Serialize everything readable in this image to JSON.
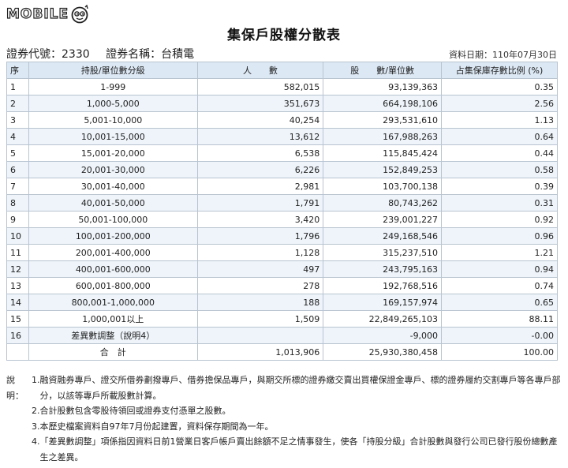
{
  "logo": {
    "text": "MOBILE"
  },
  "title": "集保戶股權分散表",
  "meta": {
    "stock_code": "證券代號：2330",
    "stock_name": "證券名稱：台積電",
    "data_date": "資料日期：110年07月30日"
  },
  "table": {
    "headers": [
      "序",
      "持股/單位數分級",
      "人　　數",
      "股　　數/單位數",
      "占集保庫存數比例 (%)"
    ],
    "rows": [
      [
        "1",
        "1-999",
        "582,015",
        "93,139,363",
        "0.35"
      ],
      [
        "2",
        "1,000-5,000",
        "351,673",
        "664,198,106",
        "2.56"
      ],
      [
        "3",
        "5,001-10,000",
        "40,254",
        "293,531,610",
        "1.13"
      ],
      [
        "4",
        "10,001-15,000",
        "13,612",
        "167,988,263",
        "0.64"
      ],
      [
        "5",
        "15,001-20,000",
        "6,538",
        "115,845,424",
        "0.44"
      ],
      [
        "6",
        "20,001-30,000",
        "6,226",
        "152,849,253",
        "0.58"
      ],
      [
        "7",
        "30,001-40,000",
        "2,981",
        "103,700,138",
        "0.39"
      ],
      [
        "8",
        "40,001-50,000",
        "1,791",
        "80,743,262",
        "0.31"
      ],
      [
        "9",
        "50,001-100,000",
        "3,420",
        "239,001,227",
        "0.92"
      ],
      [
        "10",
        "100,001-200,000",
        "1,796",
        "249,168,546",
        "0.96"
      ],
      [
        "11",
        "200,001-400,000",
        "1,128",
        "315,237,510",
        "1.21"
      ],
      [
        "12",
        "400,001-600,000",
        "497",
        "243,795,163",
        "0.94"
      ],
      [
        "13",
        "600,001-800,000",
        "278",
        "192,768,516",
        "0.74"
      ],
      [
        "14",
        "800,001-1,000,000",
        "188",
        "169,157,974",
        "0.65"
      ],
      [
        "15",
        "1,000,001以上",
        "1,509",
        "22,849,265,103",
        "88.11"
      ],
      [
        "16",
        "差異數調整（說明4）",
        "",
        "-9,000",
        "-0.00"
      ],
      [
        "",
        "合　計",
        "1,013,906",
        "25,930,380,458",
        "100.00"
      ]
    ]
  },
  "notes": {
    "label": "說明：",
    "items": [
      {
        "num": "1.",
        "text": "融資融券專戶、證交所借券劃撥專戶、借券擔保品專戶，與期交所標的證券繳交賣出買權保證金專戶、標的證券履約交割專戶等各專戶部分，以該等專戶所載股數計算。"
      },
      {
        "num": "2.",
        "text": "合計股數包含零股待領回或證券支付憑單之股數。"
      },
      {
        "num": "3.",
        "text": "本歷史檔案資料自97年7月份起建置，資料保存期間為一年。"
      },
      {
        "num": "4.",
        "text": "「差異數調整」項係指因資料日前1營業日客戶帳戶賣出餘額不足之情事發生，使各「持股分級」合計股數與發行公司已發行股份總數產生之差異。"
      }
    ]
  }
}
